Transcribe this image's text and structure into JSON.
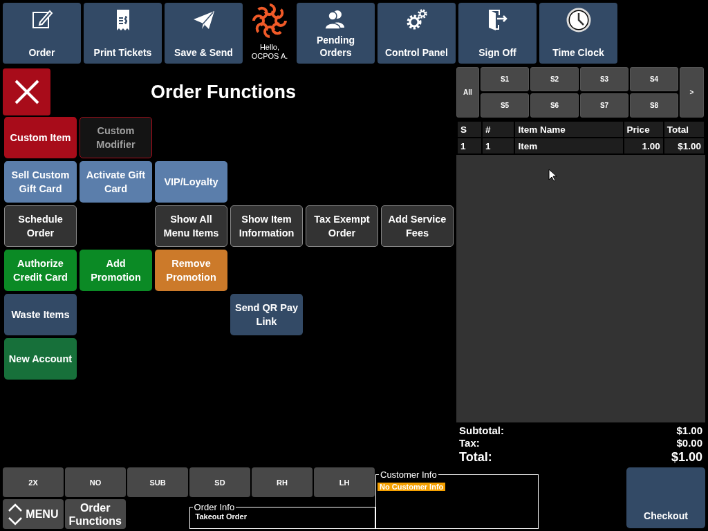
{
  "top_bar": {
    "buttons": [
      {
        "kind": "button",
        "label": "Order"
      },
      {
        "kind": "button",
        "label": "Print Tickets"
      },
      {
        "kind": "button",
        "label": "Save & Send"
      },
      {
        "kind": "greeting",
        "label": "Hello,\nOCPOS A."
      },
      {
        "kind": "button",
        "label": "Pending Orders"
      },
      {
        "kind": "button",
        "label": "Control Panel"
      },
      {
        "kind": "button",
        "label": "Sign Off"
      },
      {
        "kind": "button",
        "label": "Time Clock"
      }
    ]
  },
  "functions": {
    "title": "Order Functions",
    "rows": [
      [
        {
          "label": "Custom Item",
          "color": "#a80c1a",
          "disabled": false
        },
        {
          "label": "Custom Modifier",
          "color": "#a80c1a",
          "disabled": true
        }
      ],
      [
        {
          "label": "Sell Custom Gift Card",
          "color": "#5b7eab",
          "disabled": false
        },
        {
          "label": "Activate Gift Card",
          "color": "#5b7eab",
          "disabled": false
        },
        {
          "label": "VIP/Loyalty",
          "color": "#5b7eab",
          "disabled": false
        }
      ],
      [
        {
          "label": "Schedule Order",
          "color": "#333333",
          "disabled": false
        },
        null,
        {
          "label": "Show All Menu Items",
          "color": "#333333",
          "disabled": false
        },
        {
          "label": "Show Item Information",
          "color": "#333333",
          "disabled": false
        },
        {
          "label": "Tax Exempt Order",
          "color": "#333333",
          "disabled": false
        },
        {
          "label": "Add Service Fees",
          "color": "#333333",
          "disabled": false
        }
      ],
      [
        {
          "label": "Authorize Credit Card",
          "color": "#0b8a25",
          "disabled": false
        },
        {
          "label": "Add Promotion",
          "color": "#0b8a25",
          "disabled": false
        },
        {
          "label": "Remove Promotion",
          "color": "#cc7a2a",
          "disabled": false
        }
      ],
      [
        {
          "label": "Waste Items",
          "color": "#334a66",
          "disabled": false
        },
        null,
        null,
        {
          "label": "Send QR Pay Link",
          "color": "#334a66",
          "disabled": false
        }
      ],
      [
        {
          "label": "New Account",
          "color": "#17703a",
          "disabled": false
        }
      ]
    ]
  },
  "order": {
    "seat_all": "All",
    "seats": [
      "S1",
      "S2",
      "S3",
      "S4",
      "S5",
      "S6",
      "S7",
      "S8"
    ],
    "seat_next": ">",
    "table": {
      "columns": [
        "S",
        "#",
        "Item Name",
        "Price",
        "Total"
      ],
      "rows": [
        [
          "1",
          "1",
          "Item",
          "1.00",
          "$1.00"
        ]
      ]
    },
    "totals": [
      {
        "label": "Subtotal:",
        "value": "$1.00",
        "kind": "line"
      },
      {
        "label": "Tax:",
        "value": "$0.00",
        "kind": "line"
      },
      {
        "label": "Total:",
        "value": "$1.00",
        "kind": "grand"
      }
    ]
  },
  "bottom_bar": {
    "modifiers": [
      "2X",
      "NO",
      "SUB",
      "SD",
      "RH",
      "LH"
    ],
    "menu_button": "MENU",
    "order_functions_button": "Order Functions",
    "order_info": {
      "legend": "Order Info",
      "value": "Takeout Order"
    },
    "customer_info": {
      "legend": "Customer Info",
      "value": "No Customer Info"
    },
    "checkout_button": "Checkout"
  }
}
